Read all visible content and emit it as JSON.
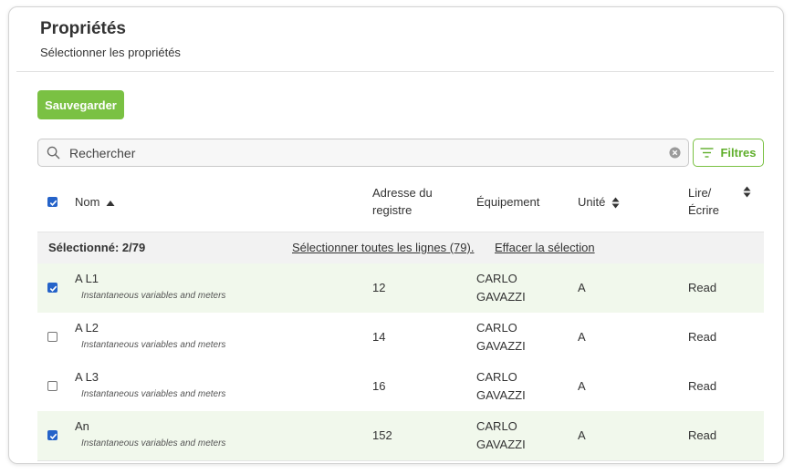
{
  "header": {
    "title": "Propriétés",
    "subtitle": "Sélectionner les propriétés"
  },
  "toolbar": {
    "save_label": "Sauvegarder"
  },
  "search": {
    "placeholder": "Rechercher",
    "value": ""
  },
  "filters": {
    "label": "Filtres"
  },
  "table": {
    "header_checked": true,
    "columns": {
      "name": "Nom",
      "address_line1": "Adresse du",
      "address_line2": "registre",
      "equipment": "Équipement",
      "unit": "Unité",
      "rw_line1": "Lire/",
      "rw_line2": "Écrire"
    },
    "selection": {
      "count_label": "Sélectionné: 2/79",
      "select_all_label": "Sélectionner toutes les lignes (79).",
      "clear_label": "Effacer la sélection"
    },
    "rows": [
      {
        "name": "A L1",
        "description": "Instantaneous variables and meters",
        "address": "12",
        "equipment_line1": "CARLO",
        "equipment_line2": "GAVAZZI",
        "unit": "A",
        "rw": "Read",
        "checked": true
      },
      {
        "name": "A L2",
        "description": "Instantaneous variables and meters",
        "address": "14",
        "equipment_line1": "CARLO",
        "equipment_line2": "GAVAZZI",
        "unit": "A",
        "rw": "Read",
        "checked": false
      },
      {
        "name": "A L3",
        "description": "Instantaneous variables and meters",
        "address": "16",
        "equipment_line1": "CARLO",
        "equipment_line2": "GAVAZZI",
        "unit": "A",
        "rw": "Read",
        "checked": false
      },
      {
        "name": "An",
        "description": "Instantaneous variables and meters",
        "address": "152",
        "equipment_line1": "CARLO",
        "equipment_line2": "GAVAZZI",
        "unit": "A",
        "rw": "Read",
        "checked": true
      }
    ]
  },
  "colors": {
    "accent_green": "#7ac143",
    "checkbox_blue": "#2563c9",
    "selected_row_bg": "#f1f8ec"
  },
  "icons": {
    "search": "search-icon",
    "clear": "clear-icon",
    "filters": "filter-lines-icon",
    "sort_asc": "sort-asc-icon",
    "sort_both": "sort-both-icon",
    "checkbox": "checkbox-check-icon"
  }
}
